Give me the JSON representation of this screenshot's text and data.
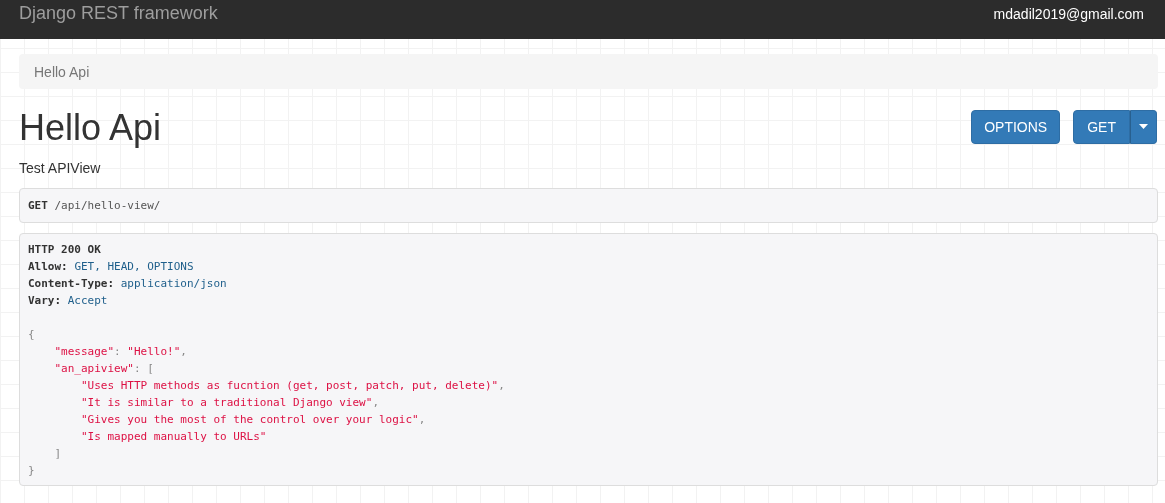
{
  "navbar": {
    "brand": "Django REST framework",
    "user": "mdadil2019@gmail.com"
  },
  "breadcrumb": [
    {
      "label": "Hello Api",
      "selected": true
    }
  ],
  "page": {
    "title": "Hello Api",
    "description": "Test APIView"
  },
  "buttons": [
    {
      "kind": "plain",
      "label": "OPTIONS"
    },
    {
      "kind": "split",
      "label": "GET"
    }
  ],
  "request": {
    "method": "GET",
    "path": "/api/hello-view/"
  },
  "response": {
    "status": "HTTP 200 OK",
    "headers": [
      {
        "name": "Allow:",
        "value": "GET, HEAD, OPTIONS"
      },
      {
        "name": "Content-Type:",
        "value": "application/json"
      },
      {
        "name": "Vary:",
        "value": "Accept"
      }
    ],
    "body": {
      "segments": [
        {
          "kind": "punct",
          "text": "{"
        }
      ],
      "children": [
        {
          "segments": [
            {
              "kind": "string",
              "text": "\"message\""
            },
            {
              "kind": "punct",
              "text": ": "
            },
            {
              "kind": "string",
              "text": "\"Hello!\""
            },
            {
              "kind": "punct",
              "text": ","
            }
          ]
        },
        {
          "segments": [
            {
              "kind": "string",
              "text": "\"an_apiview\""
            },
            {
              "kind": "punct",
              "text": ": ["
            }
          ],
          "children": [
            {
              "segments": [
                {
                  "kind": "string",
                  "text": "\"Uses HTTP methods as fucntion (get, post, patch, put, delete)\""
                },
                {
                  "kind": "punct",
                  "text": ","
                }
              ]
            },
            {
              "segments": [
                {
                  "kind": "string",
                  "text": "\"It is similar to a traditional Django view\""
                },
                {
                  "kind": "punct",
                  "text": ","
                }
              ]
            },
            {
              "segments": [
                {
                  "kind": "string",
                  "text": "\"Gives you the most of the control over your logic\""
                },
                {
                  "kind": "punct",
                  "text": ","
                }
              ]
            },
            {
              "segments": [
                {
                  "kind": "string",
                  "text": "\"Is mapped manually to URLs\""
                }
              ]
            }
          ],
          "close": [
            {
              "kind": "punct",
              "text": "]"
            }
          ]
        }
      ],
      "close": [
        {
          "kind": "punct",
          "text": "}"
        }
      ]
    }
  }
}
